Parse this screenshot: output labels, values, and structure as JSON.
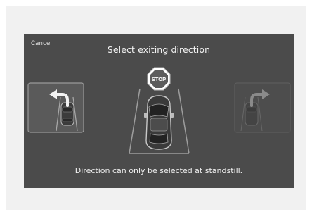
{
  "dialog": {
    "cancel_label": "Cancel",
    "title": "Select exiting direction",
    "stop_sign_text": "STOP",
    "footer_message": "Direction can only be selected at standstill."
  },
  "options": [
    {
      "direction": "left",
      "icon": "exit-left-arrow-icon",
      "enabled": true
    },
    {
      "direction": "right",
      "icon": "exit-right-arrow-icon",
      "enabled": false
    }
  ],
  "colors": {
    "screen_bg": "#4b4b4b",
    "outer_bg": "#f1f1f1",
    "text": "#f3f3f3"
  }
}
